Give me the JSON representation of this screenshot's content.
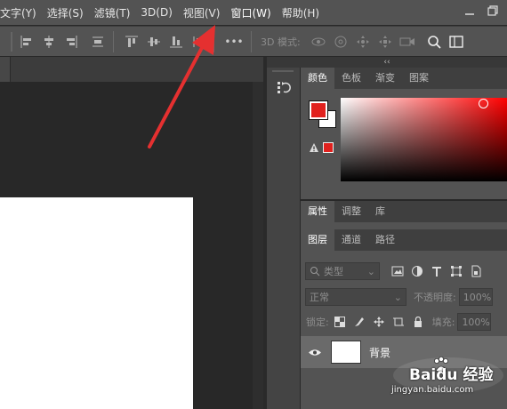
{
  "menubar": {
    "items": [
      "文字(Y)",
      "选择(S)",
      "滤镜(T)",
      "3D(D)",
      "视图(V)",
      "窗口(W)",
      "帮助(H)"
    ]
  },
  "window_controls": [
    "minimize-icon",
    "restore-icon"
  ],
  "toolbar": {
    "mode_3d_label": "3D 模式:",
    "more_label": "•••"
  },
  "color_panel": {
    "tabs": [
      "颜色",
      "色板",
      "渐变",
      "图案"
    ],
    "foreground": "#e1211e",
    "background": "#ffffff"
  },
  "props_panel": {
    "tabs": [
      "属性",
      "调整",
      "库"
    ]
  },
  "layers_panel": {
    "tabs": [
      "图层",
      "通道",
      "路径"
    ],
    "filter_label": "类型",
    "blend_mode": "正常",
    "opacity_label": "不透明度:",
    "opacity_value": "100%",
    "lock_label": "锁定:",
    "fill_label": "填充:",
    "fill_value": "100%",
    "layers": [
      {
        "name": "背景"
      }
    ]
  },
  "watermark": {
    "brand": "Baidu 经验",
    "url": "jingyan.baidu.com"
  },
  "colors": {
    "annotation_arrow": "#e53030",
    "panel_bg": "#535353",
    "canvas_bg": "#282828"
  }
}
